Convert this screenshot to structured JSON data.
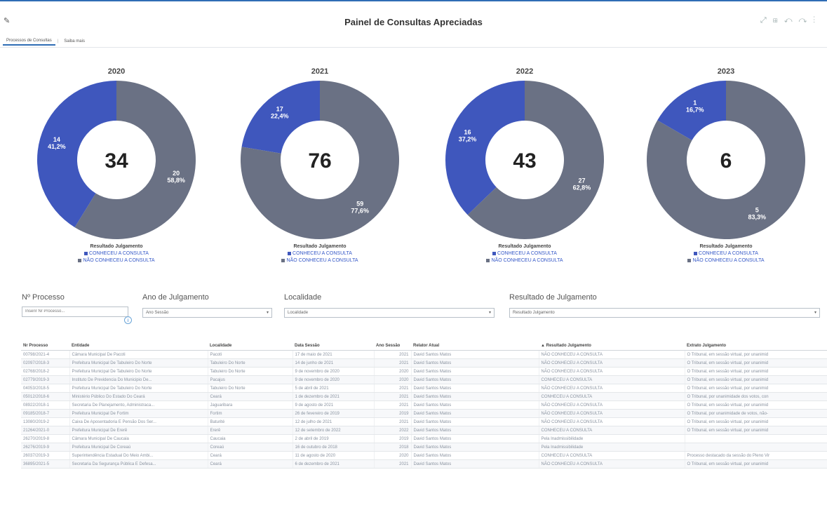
{
  "header": {
    "title": "Painel de Consultas Apreciadas",
    "edit_icon": "pencil-icon",
    "tools": [
      "expand-icon",
      "grid-icon",
      "undo-icon",
      "redo-icon",
      "more-icon"
    ]
  },
  "tabs": [
    {
      "label": "Processos de Consultas",
      "active": true
    },
    {
      "label": "Saiba mais",
      "active": false
    }
  ],
  "colors": {
    "conheceu": "#3f57bd",
    "nao_conheceu": "#6a7184",
    "accent": "#2f6db5"
  },
  "chart_data": [
    {
      "type": "pie",
      "title": "2020",
      "total": "34",
      "slices": [
        {
          "label": "CONHECEU A CONSULTA",
          "value": 14,
          "percent": "41,2%"
        },
        {
          "label": "NÃO CONHECEU A CONSULTA",
          "value": 20,
          "percent": "58,8%"
        }
      ],
      "legend_title": "Resultado Julgamento"
    },
    {
      "type": "pie",
      "title": "2021",
      "total": "76",
      "slices": [
        {
          "label": "CONHECEU A CONSULTA",
          "value": 17,
          "percent": "22,4%"
        },
        {
          "label": "NÃO CONHECEU A CONSULTA",
          "value": 59,
          "percent": "77,6%"
        }
      ],
      "legend_title": "Resultado Julgamento"
    },
    {
      "type": "pie",
      "title": "2022",
      "total": "43",
      "slices": [
        {
          "label": "CONHECEU A CONSULTA",
          "value": 16,
          "percent": "37,2%"
        },
        {
          "label": "NÃO CONHECEU A CONSULTA",
          "value": 27,
          "percent": "62,8%"
        }
      ],
      "legend_title": "Resultado Julgamento"
    },
    {
      "type": "pie",
      "title": "2023",
      "total": "6",
      "slices": [
        {
          "label": "CONHECEU A CONSULTA",
          "value": 1,
          "percent": "16,7%"
        },
        {
          "label": "NÃO CONHECEU A CONSULTA",
          "value": 5,
          "percent": "83,3%"
        }
      ],
      "legend_title": "Resultado Julgamento"
    }
  ],
  "filters": {
    "processo": {
      "label": "Nº Processo",
      "placeholder": "Inserir Nr Processo..."
    },
    "ano": {
      "label": "Ano de Julgamento",
      "value": "Ano Sessão"
    },
    "localidade": {
      "label": "Localidade",
      "value": "Localidade"
    },
    "resultado": {
      "label": "Resultado de Julgamento",
      "value": "Resultado Julgamento"
    }
  },
  "table": {
    "columns": [
      "Nr Processo",
      "Entidade",
      "Localidade",
      "Data Sessão",
      "Ano Sessão",
      "Relator Atual",
      "Resultado Julgamento",
      "Extrato Julgamento"
    ],
    "rows": [
      [
        "00798/2021-4",
        "Câmara Municipal De Pacoti",
        "Pacoti",
        "17 de maio de 2021",
        "2021",
        "David Santos Matos",
        "NÃO CONHECEU A CONSULTA",
        "O Tribunal, em sessão virtual, por unanimid"
      ],
      [
        "02097/2018-3",
        "Prefeitura Municipal De Tabuleiro Do Norte",
        "Tabuleiro Do Norte",
        "14 de junho de 2021",
        "2021",
        "David Santos Matos",
        "NÃO CONHECEU A CONSULTA",
        "O Tribunal, em sessão virtual, por unanimid"
      ],
      [
        "02768/2018-2",
        "Prefeitura Municipal De Tabuleiro Do Norte",
        "Tabuleiro Do Norte",
        "9 de novembro de 2020",
        "2020",
        "David Santos Matos",
        "NÃO CONHECEU A CONSULTA",
        "O Tribunal, em sessão virtual, por unanimid"
      ],
      [
        "02779/2019-3",
        "Instituto De Previdencia Do Municipio De...",
        "Pacajus",
        "9 de novembro de 2020",
        "2020",
        "David Santos Matos",
        "CONHECEU A CONSULTA",
        "O Tribunal, em sessão virtual, por unanimid"
      ],
      [
        "04053/2018-5",
        "Prefeitura Municipal De Tabuleiro Do Norte",
        "Tabuleiro Do Norte",
        "5 de abril de 2021",
        "2021",
        "David Santos Matos",
        "NÃO CONHECEU A CONSULTA",
        "O Tribunal, em sessão virtual, por unanimid"
      ],
      [
        "05012/2018-6",
        "Ministério Público Do Estado Do Ceará",
        "Ceará",
        "1 de dezembro de 2021",
        "2021",
        "David Santos Matos",
        "CONHECEU A CONSULTA",
        "O Tribunal, por unanimidade dos votos, con"
      ],
      [
        "08922/2018-1",
        "Secretaria De Planejamento, Administraca...",
        "Jaguaribara",
        "9 de agosto de 2021",
        "2021",
        "David Santos Matos",
        "NÃO CONHECEU A CONSULTA",
        "O Tribunal, em sessão virtual, por unanimid"
      ],
      [
        "09185/2018-7",
        "Prefeitura Municipal De Fortim",
        "Fortim",
        "26 de fevereiro de 2019",
        "2019",
        "David Santos Matos",
        "NÃO CONHECEU A CONSULTA",
        "O Tribunal, por unanimidade de votos, não-"
      ],
      [
        "13080/2019-2",
        "Caixa De Aposentadoria E Pensão Dos Ser...",
        "Baturité",
        "12 de julho de 2021",
        "2021",
        "David Santos Matos",
        "NÃO CONHECEU A CONSULTA",
        "O Tribunal, em sessão virtual, por unanimid"
      ],
      [
        "21264/2021-0",
        "Prefeitura Municipal De Ererê",
        "Ererê",
        "12 de setembro de 2022",
        "2022",
        "David Santos Matos",
        "CONHECEU A CONSULTA",
        "O Tribunal, em sessão virtual, por unanimid"
      ],
      [
        "26270/2019-8",
        "Câmara Municipal De Caucaia",
        "Caucaia",
        "2 de abril de 2019",
        "2019",
        "David Santos Matos",
        "Pela Inadmissibilidade",
        ""
      ],
      [
        "26276/2019-9",
        "Prefeitura Municipal De Coreaú",
        "Coreaú",
        "16 de outubro de 2018",
        "2018",
        "David Santos Matos",
        "Pela Inadmissibilidade",
        ""
      ],
      [
        "26037/2019-3",
        "Superintendência Estadual Do Meio Ambi...",
        "Ceará",
        "11 de agosto de 2020",
        "2020",
        "David Santos Matos",
        "CONHECEU A CONSULTA",
        "Processo destacado da sessão do Pleno Vir"
      ],
      [
        "36895/2021-5",
        "Secretaria Da Segurança Pública E Defesa...",
        "Ceará",
        "6 de dezembro de 2021",
        "2021",
        "David Santos Matos",
        "NÃO CONHECEU A CONSULTA",
        "O Tribunal, em sessão virtual, por unanimid"
      ]
    ]
  }
}
